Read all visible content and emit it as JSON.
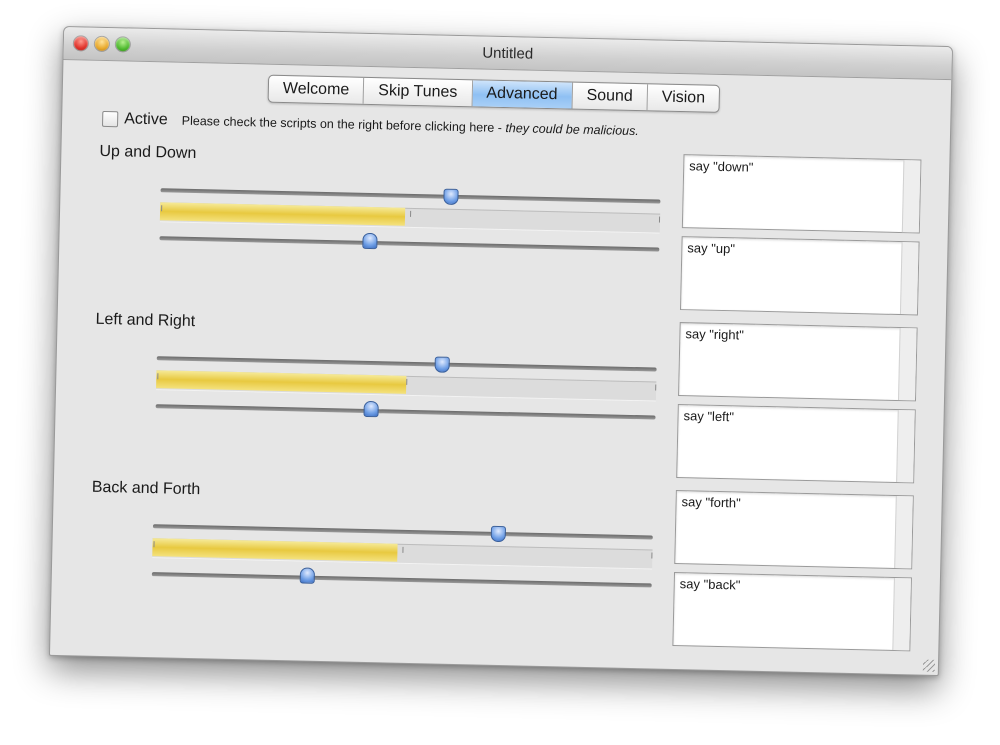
{
  "window": {
    "title": "Untitled"
  },
  "tabs": [
    {
      "label": "Welcome",
      "selected": false
    },
    {
      "label": "Skip Tunes",
      "selected": false
    },
    {
      "label": "Advanced",
      "selected": true
    },
    {
      "label": "Sound",
      "selected": false
    },
    {
      "label": "Vision",
      "selected": false
    }
  ],
  "active": {
    "label": "Active",
    "checked": false,
    "warning_plain": "Please check the scripts on the right before clicking here - ",
    "warning_italic": "they could be malicious."
  },
  "sections": [
    {
      "title": "Up and Down",
      "top_slider_value": 0.58,
      "bottom_slider_value": 0.42,
      "level_fill": 0.49,
      "scripts": [
        "say \"down\"",
        "say \"up\""
      ]
    },
    {
      "title": "Left and Right",
      "top_slider_value": 0.57,
      "bottom_slider_value": 0.43,
      "level_fill": 0.5,
      "scripts": [
        "say \"right\"",
        "say \"left\""
      ]
    },
    {
      "title": "Back and Forth",
      "top_slider_value": 0.69,
      "bottom_slider_value": 0.31,
      "level_fill": 0.49,
      "scripts": [
        "say \"forth\"",
        "say \"back\""
      ]
    }
  ],
  "colors": {
    "level_fill": "#e8c940",
    "tab_selected": "#8fc0f3",
    "knob": "#6f9fe6"
  }
}
